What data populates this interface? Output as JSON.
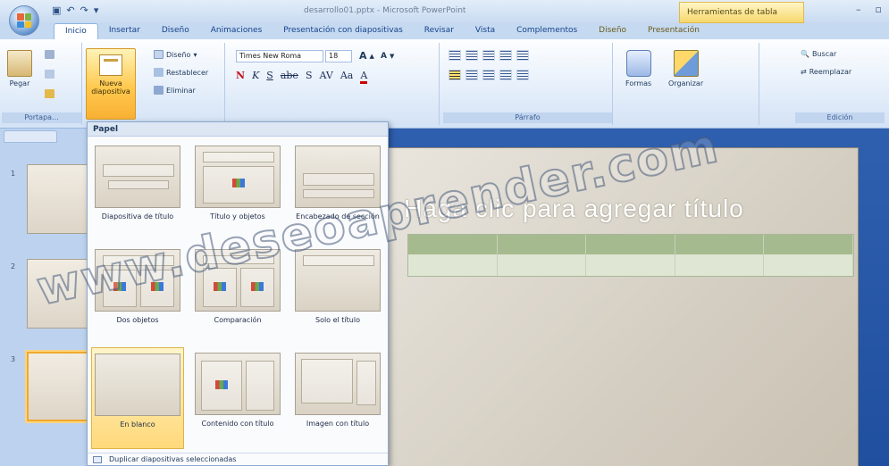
{
  "window": {
    "title": "desarrollo01.pptx - Microsoft PowerPoint",
    "context_tab_header": "Herramientas de tabla"
  },
  "tabs": [
    "Inicio",
    "Insertar",
    "Diseño",
    "Animaciones",
    "Presentación con diapositivas",
    "Revisar",
    "Vista",
    "Complementos",
    "Diseño",
    "Presentación"
  ],
  "ribbon": {
    "clipboard": {
      "paste_label": "Pegar",
      "group_label": "Portapa..."
    },
    "slides": {
      "new_slide_label": "Nueva diapositiva",
      "layout_label": "Diseño",
      "reset_label": "Restablecer",
      "delete_label": "Eliminar"
    },
    "font": {
      "name": "Times New Roma",
      "size": "18"
    },
    "paragraph": {
      "group_label": "Párrafo"
    },
    "drawing": {
      "shapes_label": "Formas",
      "arrange_label": "Organizar"
    },
    "editing": {
      "find_label": "Buscar",
      "replace_label": "Reemplazar",
      "group_label": "Edición"
    }
  },
  "dropdown": {
    "header": "Papel",
    "layouts": [
      {
        "label": "Diapositiva de título"
      },
      {
        "label": "Título y objetos"
      },
      {
        "label": "Encabezado de sección"
      },
      {
        "label": "Dos objetos"
      },
      {
        "label": "Comparación"
      },
      {
        "label": "Solo el título"
      },
      {
        "label": "En blanco"
      },
      {
        "label": "Contenido con título"
      },
      {
        "label": "Imagen con título"
      }
    ],
    "footer": "Duplicar diapositivas seleccionadas"
  },
  "slide": {
    "title_placeholder": "Haga clic para agregar título"
  },
  "watermark": "www.deseoaprender.com"
}
